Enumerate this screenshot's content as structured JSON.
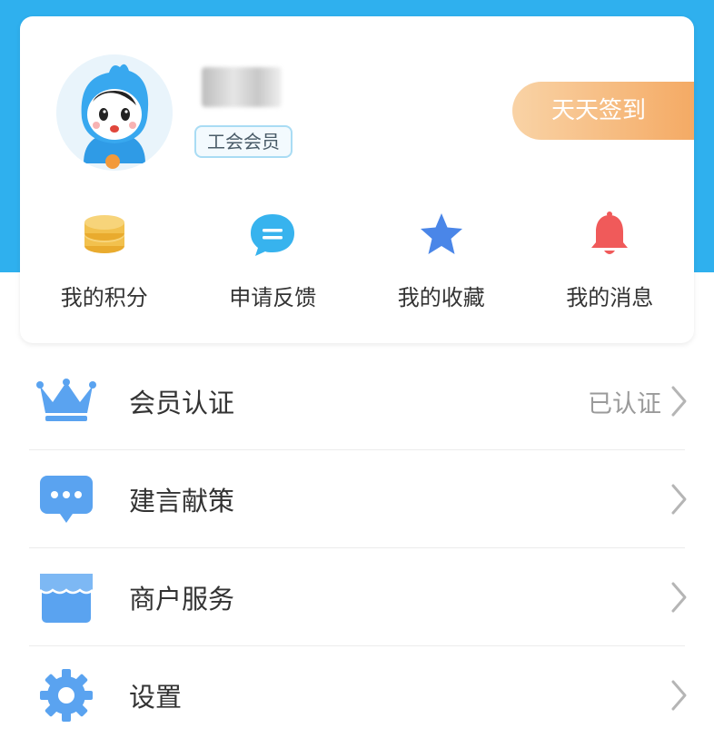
{
  "profile": {
    "member_badge": "工会会员",
    "checkin_label": "天天签到"
  },
  "quick_actions": [
    {
      "label": "我的积分",
      "icon": "coins-icon"
    },
    {
      "label": "申请反馈",
      "icon": "chat-bubble-icon"
    },
    {
      "label": "我的收藏",
      "icon": "star-icon"
    },
    {
      "label": "我的消息",
      "icon": "bell-icon"
    }
  ],
  "menu": [
    {
      "label": "会员认证",
      "status": "已认证",
      "icon": "crown-icon"
    },
    {
      "label": "建言献策",
      "status": "",
      "icon": "message-icon"
    },
    {
      "label": "商户服务",
      "status": "",
      "icon": "store-icon"
    },
    {
      "label": "设置",
      "status": "",
      "icon": "gear-icon"
    }
  ],
  "colors": {
    "header_blue": "#2fb0ee",
    "checkin_orange": "#f4a861",
    "icon_blue": "#4a9ef0",
    "bell_red": "#f05a5a",
    "coin_yellow": "#f2c14e"
  }
}
